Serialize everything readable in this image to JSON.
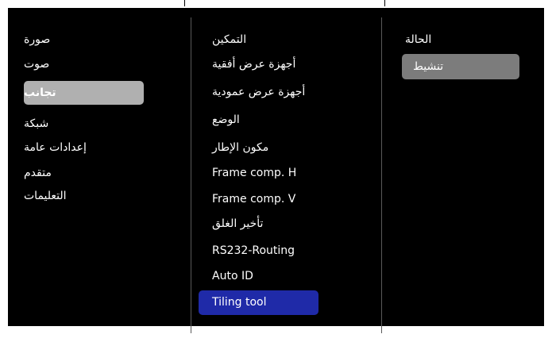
{
  "col1": {
    "items": [
      {
        "label": "صورة"
      },
      {
        "label": "صوت"
      },
      {
        "label": "تجانب"
      },
      {
        "label": "شبكة"
      },
      {
        "label": "إعدادات عامة"
      },
      {
        "label": "متقدم"
      },
      {
        "label": "التعليمات"
      }
    ],
    "selected_index": 2
  },
  "col2": {
    "items": [
      {
        "label": "التمكين"
      },
      {
        "label": "أجهزة عرض أفقية"
      },
      {
        "label": "أجهزة عرض عمودية"
      },
      {
        "label": "الوضع"
      },
      {
        "label": "مكون الإطار"
      },
      {
        "label": "Frame comp. H"
      },
      {
        "label": "Frame comp. V"
      },
      {
        "label": "تأخير الغلق"
      },
      {
        "label": "RS232-Routing"
      },
      {
        "label": "Auto ID"
      },
      {
        "label": "Tiling tool"
      }
    ],
    "selected_index": 10
  },
  "col3": {
    "title": "الحالة",
    "option": "تنشيط"
  },
  "colors": {
    "background": "#000000",
    "selected_grey": "#b0b0b0",
    "option_grey": "#7c7c7c",
    "focus_blue": "#1f2aa8",
    "text": "#ffffff"
  }
}
